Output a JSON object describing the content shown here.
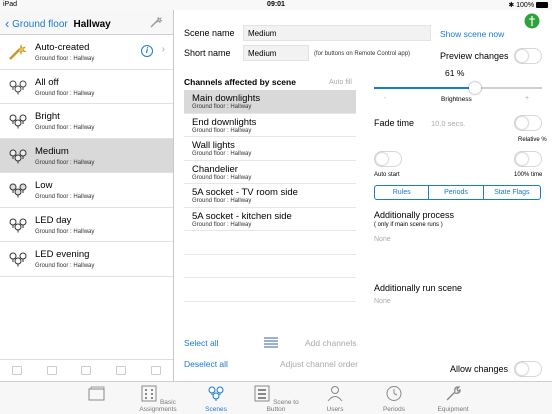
{
  "status": {
    "device": "iPad",
    "time": "09:01",
    "battery": "100%"
  },
  "left": {
    "back_label": "Ground floor",
    "title": "Hallway",
    "scenes": [
      {
        "name": "Auto-created",
        "location": "Ground floor : Hallway",
        "icon": "magic-wand-icon",
        "selected": false,
        "has_info": true
      },
      {
        "name": "All off",
        "location": "Ground floor : Hallway",
        "icon": "bulbs-off-icon",
        "selected": false
      },
      {
        "name": "Bright",
        "location": "Ground floor : Hallway",
        "icon": "bulbs-bright-icon",
        "selected": false
      },
      {
        "name": "Medium",
        "location": "Ground floor : Hallway",
        "icon": "bulbs-medium-icon",
        "selected": true
      },
      {
        "name": "Low",
        "location": "Ground floor : Hallway",
        "icon": "bulbs-low-icon",
        "selected": false
      },
      {
        "name": "LED day",
        "location": "Ground floor : Hallway",
        "icon": "bulbs-led-icon",
        "selected": false
      },
      {
        "name": "LED evening",
        "location": "Ground floor : Hallway",
        "icon": "bulbs-led-icon",
        "selected": false
      }
    ]
  },
  "detail": {
    "scene_name_label": "Scene name",
    "scene_name_value": "Medium",
    "show_scene_label": "Show scene now",
    "short_name_label": "Short name",
    "short_name_value": "Medium",
    "short_name_hint": "(for buttons on Remote Control app)",
    "channels_header": "Channels affected by scene",
    "auto_fill": "Auto fill",
    "channels": [
      {
        "name": "Main downlights",
        "location": "Ground floor : Hallway",
        "selected": true
      },
      {
        "name": "End downlights",
        "location": "Ground floor : Hallway",
        "selected": false
      },
      {
        "name": "Wall lights",
        "location": "Ground floor : Hallway",
        "selected": false
      },
      {
        "name": "Chandelier",
        "location": "Ground floor : Hallway",
        "selected": false
      },
      {
        "name": "5A socket - TV room side",
        "location": "Ground floor : Hallway",
        "selected": false
      },
      {
        "name": "5A socket - kitchen side",
        "location": "Ground floor : Hallway",
        "selected": false
      }
    ],
    "select_all": "Select all",
    "deselect_all": "Deselect all",
    "add_channels": "Add channels",
    "adjust_order": "Adjust channel order",
    "preview_changes": "Preview changes",
    "brightness_percent": "61 %",
    "brightness_value": 61,
    "brightness_minus": "-",
    "brightness_plus": "+",
    "brightness_label": "Brightness",
    "fade_time_label": "Fade time",
    "fade_time_value": "10.0 secs.",
    "relative_label": "Relative %",
    "auto_start_label": "Auto start",
    "hundred_time_label": "100% time",
    "segments": [
      "Rules",
      "Periods",
      "State Flags"
    ],
    "additional_process_title": "Additionally process",
    "additional_process_sub": "( only if main scene runs )",
    "none_1": "None",
    "additional_run_title": "Additionally run scene",
    "none_2": "None",
    "allow_changes": "Allow changes"
  },
  "tabs": [
    {
      "label": "",
      "icon": "folders-icon",
      "active": false
    },
    {
      "label": "Basic Assignments",
      "icon": "grid-icon",
      "active": false
    },
    {
      "label": "Scenes",
      "icon": "scenes-icon",
      "active": true
    },
    {
      "label": "Scene to Button",
      "icon": "keypad-icon",
      "active": false
    },
    {
      "label": "Users",
      "icon": "user-icon",
      "active": false
    },
    {
      "label": "Periods",
      "icon": "clock-icon",
      "active": false
    },
    {
      "label": "Equipment",
      "icon": "wrench-icon",
      "active": false
    }
  ],
  "colors": {
    "accent": "#1a7ad4",
    "selected_row": "#d9d9d9",
    "indicator_green": "#2fa33a"
  }
}
